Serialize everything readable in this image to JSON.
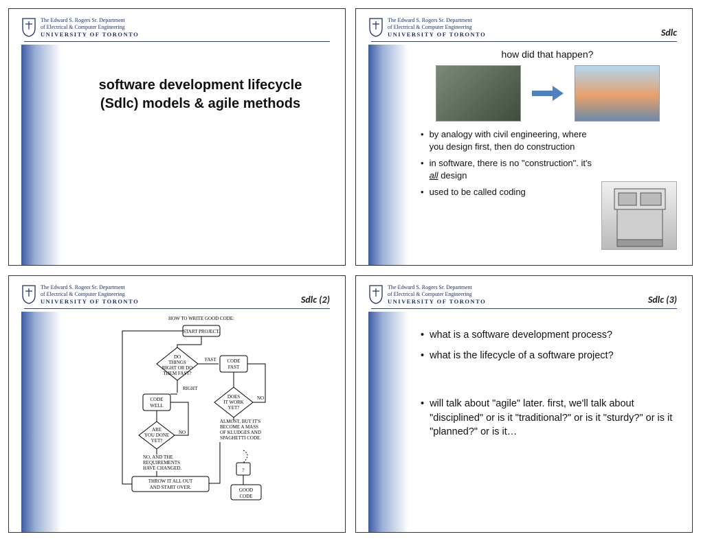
{
  "logo": {
    "dept1": "The Edward S. Rogers Sr. Department",
    "dept2": "of Electrical & Computer Engineering",
    "univ": "UNIVERSITY OF TORONTO"
  },
  "slide1": {
    "title": "software development lifecycle (Sdlc) models & agile methods"
  },
  "slide2": {
    "corner": "Sdlc",
    "heading": "how did that happen?",
    "bullets": [
      "by analogy with civil engineering, where you design first, then do construction",
      "in software, there is no \"construction\". it's all design",
      "used to be called coding"
    ],
    "underline_word": "all"
  },
  "slide3": {
    "corner": "Sdlc (2)",
    "xkcd_title": "HOW TO WRITE GOOD CODE:",
    "labels": {
      "start": "START PROJECT.",
      "do_things": "DO THINGS RIGHT OR DO THEM FAST?",
      "fast": "FAST",
      "right": "RIGHT",
      "code_fast": "CODE FAST",
      "code_well": "CODE WELL",
      "does_work": "DOES IT WORK YET?",
      "no": "NO",
      "almost": "ALMOST, BUT IT'S BECOME A MASS OF KLUDGES AND SPAGHETTI CODE.",
      "done_yet": "ARE YOU DONE YET?",
      "no_req": "NO, AND THE REQUIREMENTS HAVE CHANGED.",
      "throw": "THROW IT ALL OUT AND START OVER.",
      "q": "?",
      "good": "GOOD CODE"
    }
  },
  "slide4": {
    "corner": "Sdlc (3)",
    "bullets_a": [
      "what is a software development process?",
      "what is the lifecycle of a software project?"
    ],
    "bullets_b": [
      "will talk about \"agile\" later. first, we'll talk about \"disciplined\" or is it \"traditional?\" or is it  \"sturdy?\" or is it \"planned?\" or is it…"
    ]
  }
}
